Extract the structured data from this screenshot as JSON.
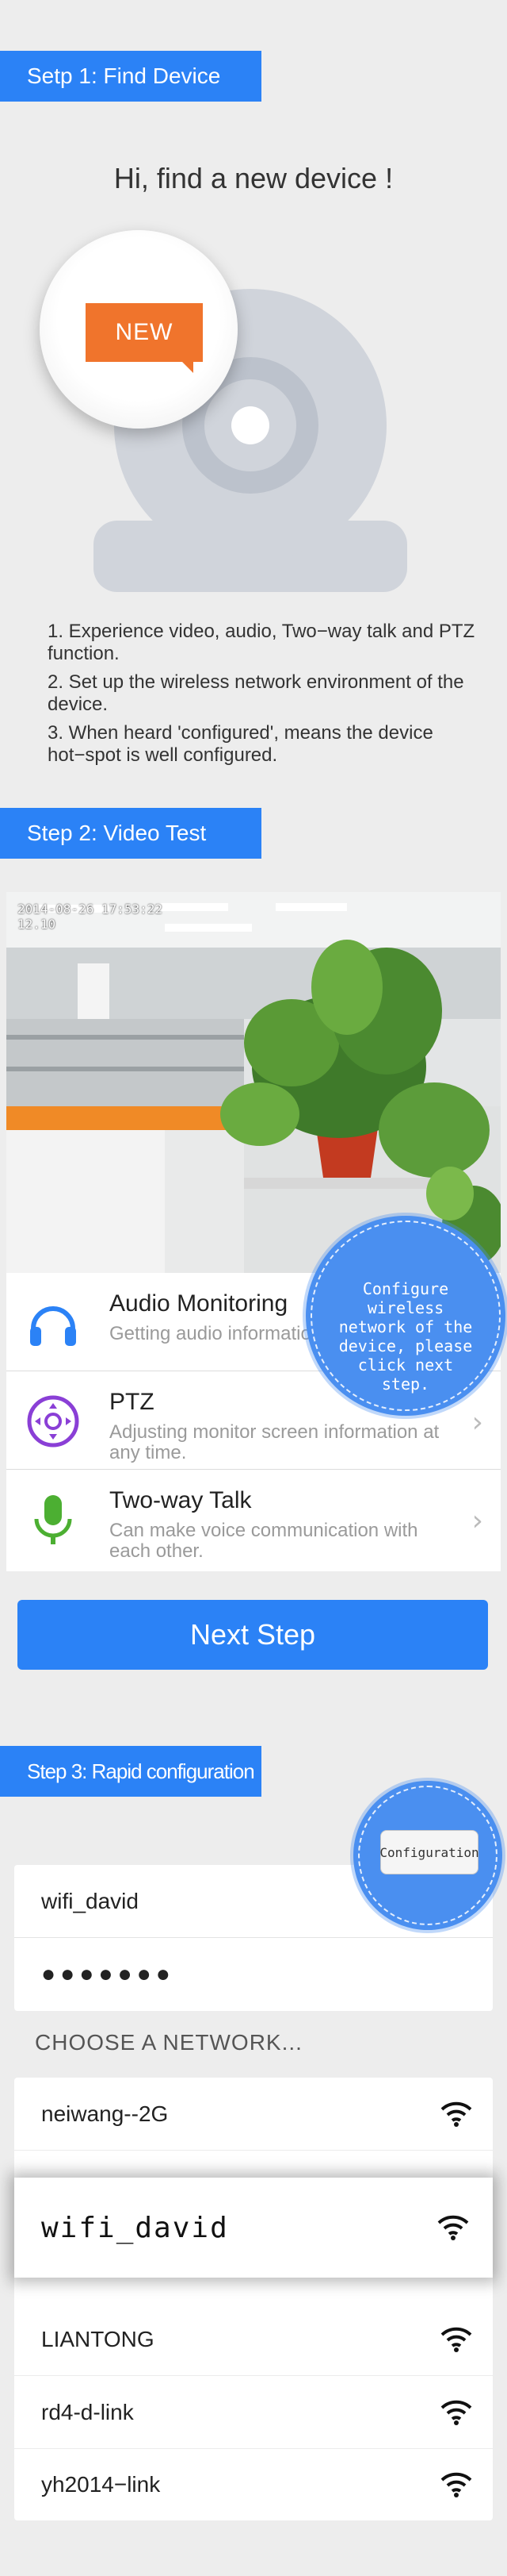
{
  "step1": {
    "banner": "Setp 1: Find Device",
    "headline": "Hi, find a new device !",
    "badge": "NEW",
    "instructions": [
      "1. Experience video, audio, Two−way talk and PTZ function.",
      "2. Set up the wireless network environment of the device.",
      "3. When heard 'configured', means the device hot−spot is well configured."
    ]
  },
  "step2": {
    "banner": "Step 2: Video Test",
    "timestamp_line1": "2014-08-26 17:53:22",
    "timestamp_line2": "12.10",
    "features": [
      {
        "title": "Audio Monitoring",
        "desc": "Getting audio information"
      },
      {
        "title": "PTZ",
        "desc": "Adjusting monitor screen information at any time."
      },
      {
        "title": "Two-way Talk",
        "desc": "Can make voice communication with each other."
      }
    ],
    "tooltip": "Configure wireless network of the device, please click next step.",
    "next_button": "Next Step"
  },
  "step3": {
    "banner": "Step 3: Rapid configuration",
    "configuration_button": "Configuration",
    "ssid": "wifi_david",
    "password": "●●●●●●●",
    "choose_label": "CHOOSE A NETWORK...",
    "networks": [
      "neiwang--2G",
      "LIANTONG",
      "rd4-d-link",
      "yh2014−link"
    ],
    "selected_network": "wifi_david"
  },
  "colors": {
    "accent": "#2b82f6",
    "badge": "#f0742c",
    "background": "#ededed",
    "camera_silhouette": "#d0d4db"
  }
}
